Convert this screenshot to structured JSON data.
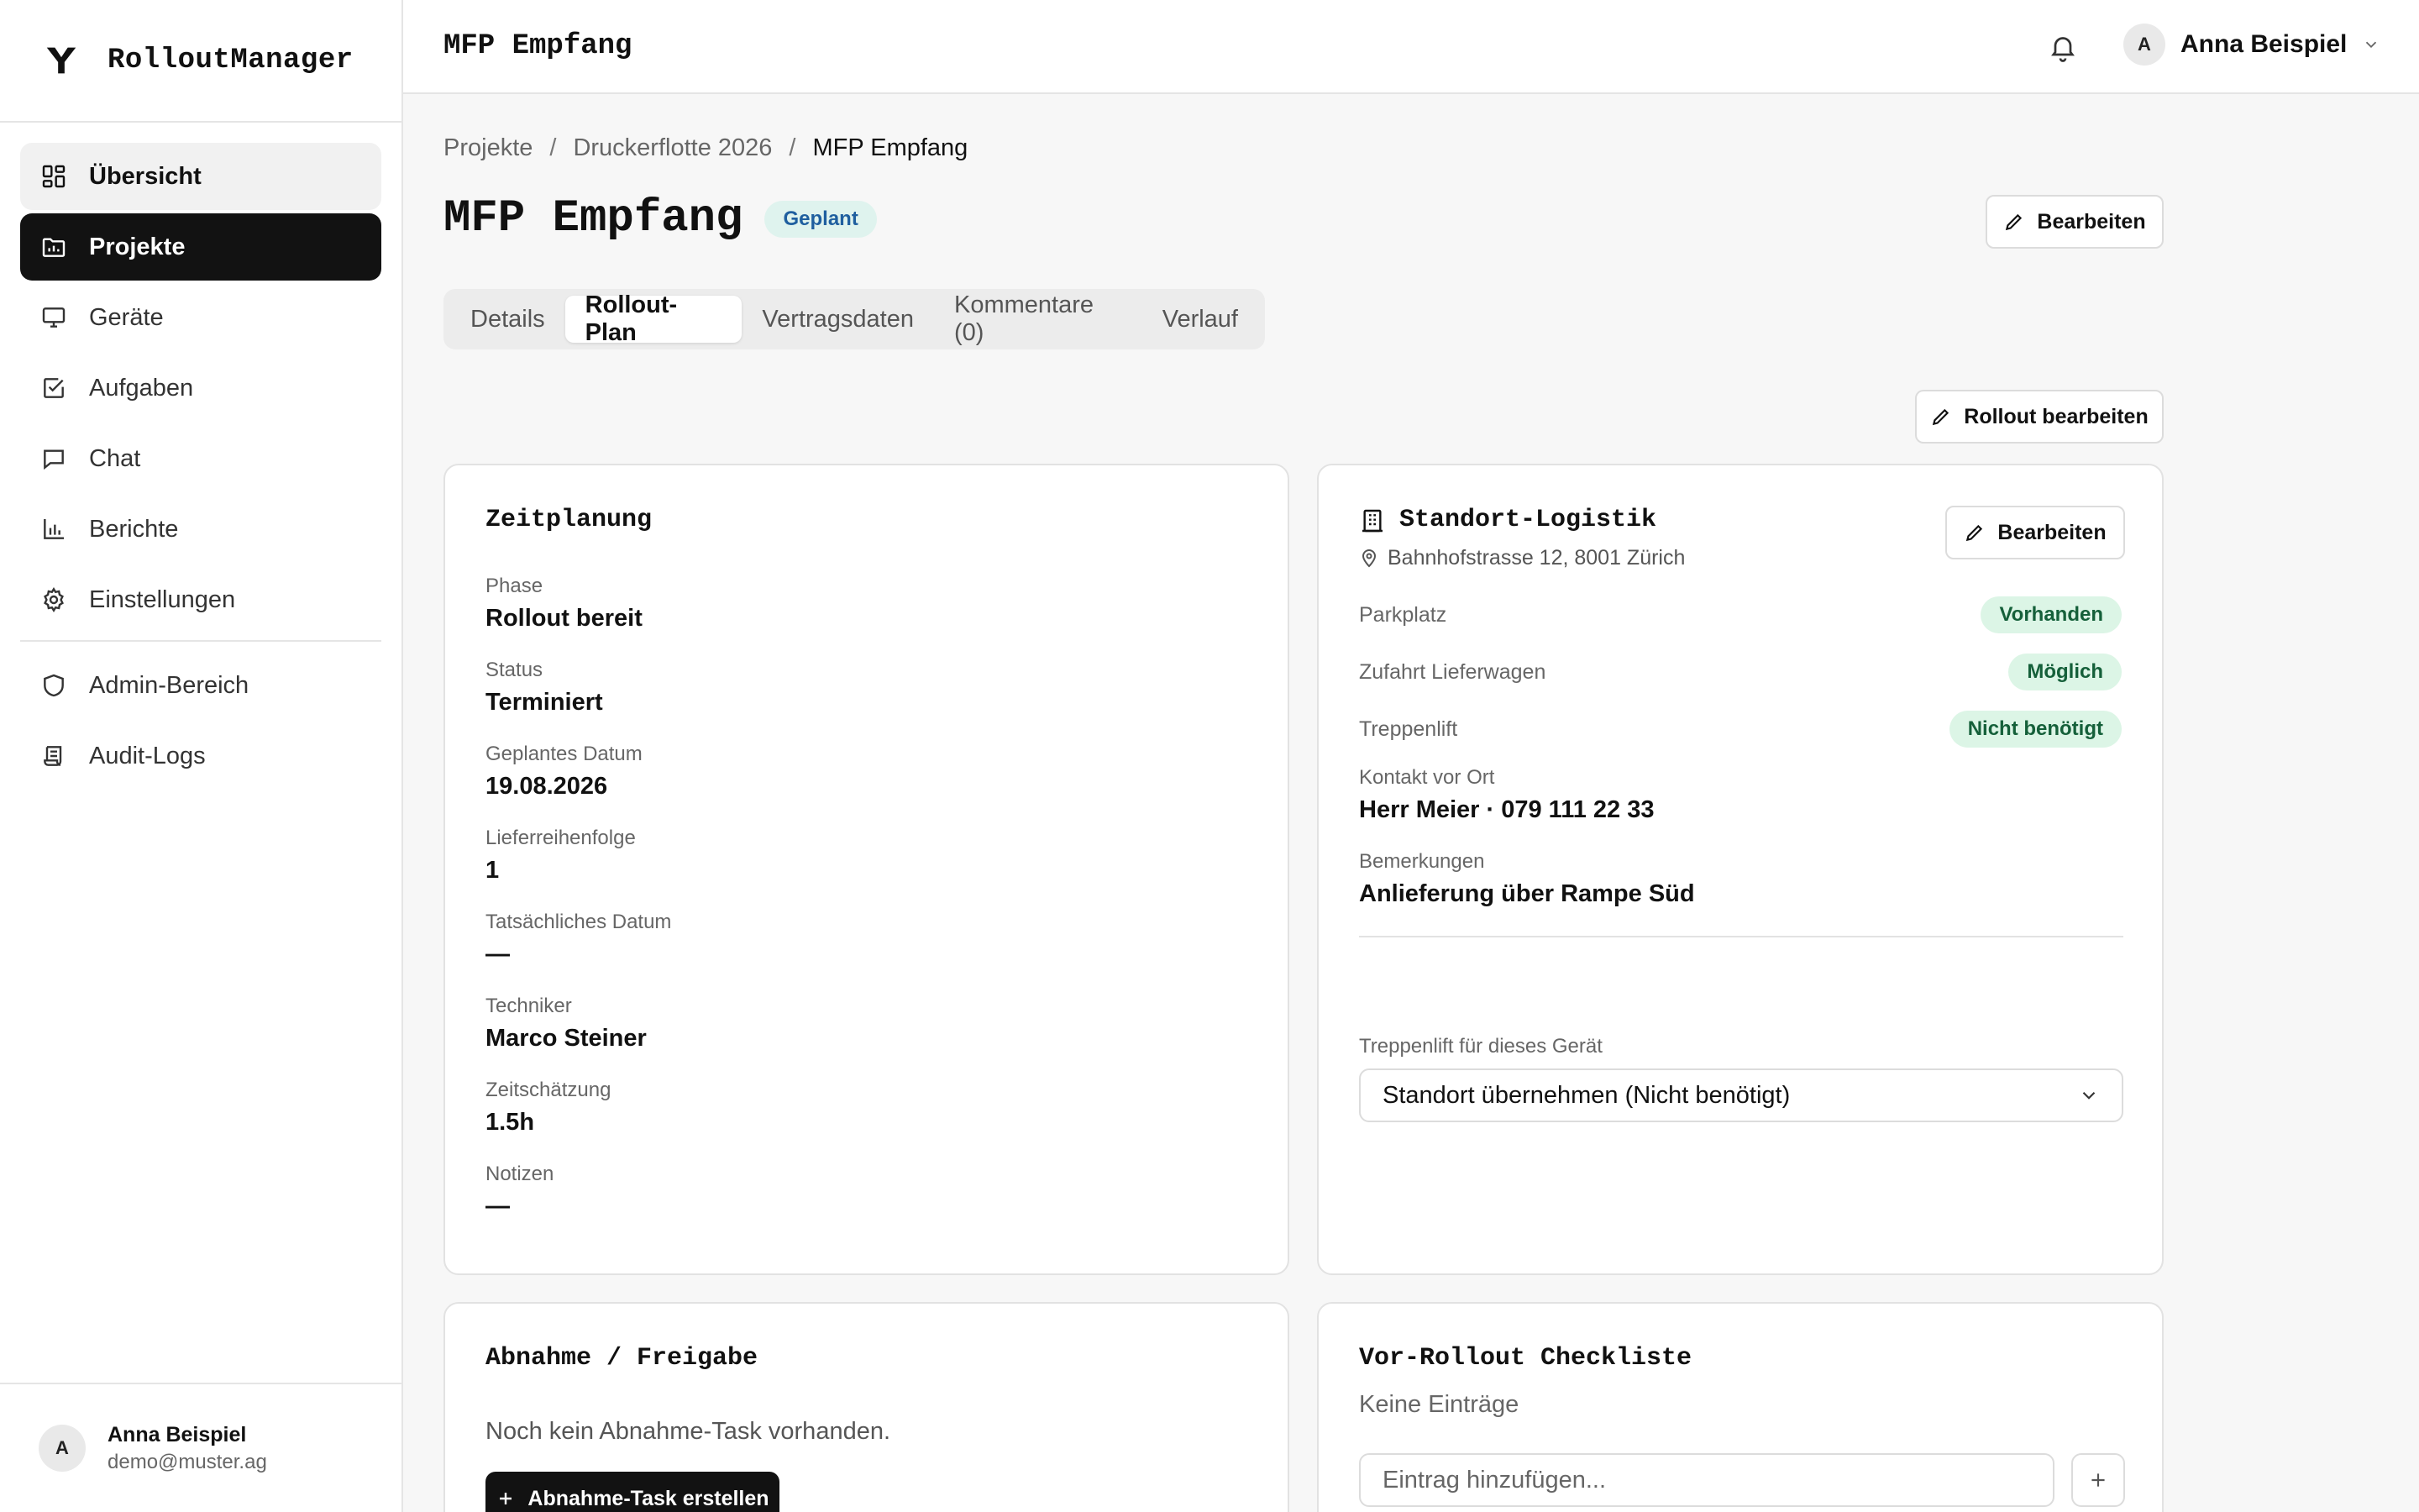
{
  "app": {
    "name": "RolloutManager"
  },
  "sidebar": {
    "items": [
      {
        "label": "Übersicht",
        "icon": "dashboard-icon"
      },
      {
        "label": "Projekte",
        "icon": "folder-chart-icon"
      },
      {
        "label": "Geräte",
        "icon": "monitor-icon"
      },
      {
        "label": "Aufgaben",
        "icon": "checkbox-icon"
      },
      {
        "label": "Chat",
        "icon": "chat-icon"
      },
      {
        "label": "Berichte",
        "icon": "bar-chart-icon"
      },
      {
        "label": "Einstellungen",
        "icon": "gear-icon"
      }
    ],
    "admin_items": [
      {
        "label": "Admin-Bereich",
        "icon": "shield-icon"
      },
      {
        "label": "Audit-Logs",
        "icon": "scroll-icon"
      }
    ],
    "user": {
      "initial": "A",
      "name": "Anna Beispiel",
      "email": "demo@muster.ag"
    }
  },
  "topbar": {
    "title": "MFP Empfang",
    "user": {
      "initial": "A",
      "name": "Anna Beispiel"
    }
  },
  "breadcrumb": [
    "Projekte",
    "Druckerflotte 2026",
    "MFP Empfang"
  ],
  "page": {
    "title": "MFP Empfang",
    "status_badge": "Geplant",
    "edit_label": "Bearbeiten",
    "rollout_edit_label": "Rollout bearbeiten"
  },
  "tabs": [
    "Details",
    "Rollout-Plan",
    "Vertragsdaten",
    "Kommentare (0)",
    "Verlauf"
  ],
  "active_tab": "Rollout-Plan",
  "zeitplanung": {
    "title": "Zeitplanung",
    "fields": [
      {
        "label": "Phase",
        "value": "Rollout bereit"
      },
      {
        "label": "Status",
        "value": "Terminiert"
      },
      {
        "label": "Geplantes Datum",
        "value": "19.08.2026"
      },
      {
        "label": "Lieferreihenfolge",
        "value": "1"
      },
      {
        "label": "Tatsächliches Datum",
        "value": "—"
      },
      {
        "label": "Techniker",
        "value": "Marco Steiner"
      },
      {
        "label": "Zeitschätzung",
        "value": "1.5h"
      },
      {
        "label": "Notizen",
        "value": "—"
      }
    ]
  },
  "logistik": {
    "title": "Standort-Logistik",
    "address": "Bahnhofstrasse 12, 8001 Zürich",
    "edit_label": "Bearbeiten",
    "rows": [
      {
        "label": "Parkplatz",
        "value": "Vorhanden"
      },
      {
        "label": "Zufahrt Lieferwagen",
        "value": "Möglich"
      },
      {
        "label": "Treppenlift",
        "value": "Nicht benötigt"
      }
    ],
    "contact": {
      "label": "Kontakt vor Ort",
      "value": "Herr Meier · 079 111 22 33"
    },
    "remarks": {
      "label": "Bemerkungen",
      "value": "Anlieferung über Rampe Süd"
    },
    "stairlift_select": {
      "label": "Treppenlift für dieses Gerät",
      "value": "Standort übernehmen (Nicht benötigt)"
    }
  },
  "abnahme": {
    "title": "Abnahme / Freigabe",
    "empty_text": "Noch kein Abnahme-Task vorhanden.",
    "create_label": "Abnahme-Task erstellen"
  },
  "checkliste": {
    "title": "Vor-Rollout Checkliste",
    "empty_text": "Keine Einträge",
    "input_placeholder": "Eintrag hinzufügen..."
  }
}
